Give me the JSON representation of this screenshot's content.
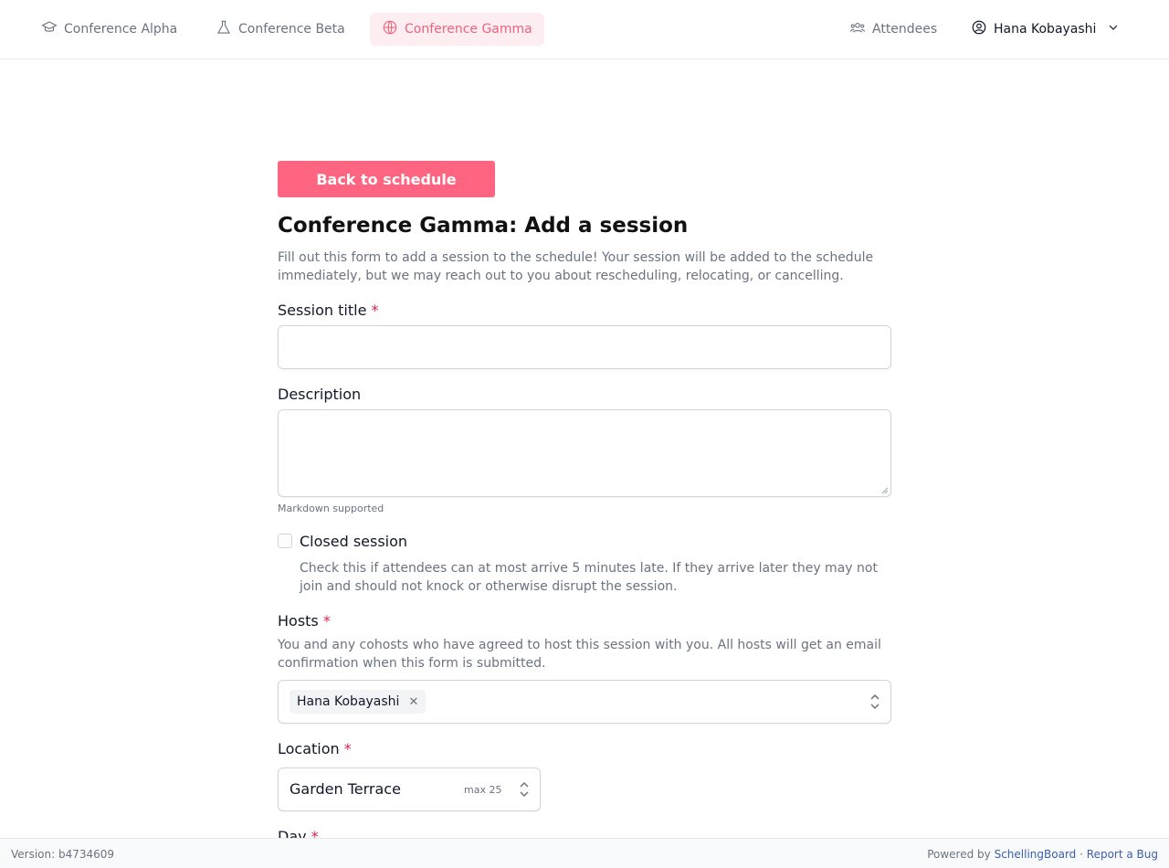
{
  "nav": {
    "alpha": "Conference Alpha",
    "beta": "Conference Beta",
    "gamma": "Conference Gamma",
    "attendees": "Attendees",
    "user": "Hana Kobayashi"
  },
  "form": {
    "back_label": "Back to schedule",
    "title": "Conference Gamma: Add a session",
    "intro": "Fill out this form to add a session to the schedule! Your session will be added to the schedule immediately, but we may reach out to you about rescheduling, relocating, or cancelling.",
    "session_title_label": "Session title",
    "session_title_value": "",
    "description_label": "Description",
    "description_value": "",
    "markdown_hint": "Markdown supported",
    "closed_label": "Closed session",
    "closed_help": "Check this if attendees can at most arrive 5 minutes late. If they arrive later they may not join and should not knock or otherwise disrupt the session.",
    "closed_checked": false,
    "hosts_label": "Hosts",
    "hosts_help": "You and any cohosts who have agreed to host this session with you. All hosts will get an email confirmation when this form is submitted.",
    "hosts": [
      "Hana Kobayashi"
    ],
    "location_label": "Location",
    "location_value": "Garden Terrace",
    "location_max": "max 25",
    "day_label": "Day",
    "required_mark": "*"
  },
  "footer": {
    "version": "Version: b4734609",
    "powered_by": "Powered by",
    "brand": "SchellingBoard",
    "separator": "·",
    "report": "Report a Bug"
  },
  "colors": {
    "accent": "#ff6580",
    "accent_soft": "#ffeef1",
    "required": "#e11d48",
    "link": "#3b5fa8"
  },
  "icons": {
    "alpha": "graduation-cap-icon",
    "beta": "flask-icon",
    "gamma": "globe-icon",
    "attendees": "users-icon",
    "user": "user-circle-icon",
    "chevron": "chevron-down-icon"
  }
}
